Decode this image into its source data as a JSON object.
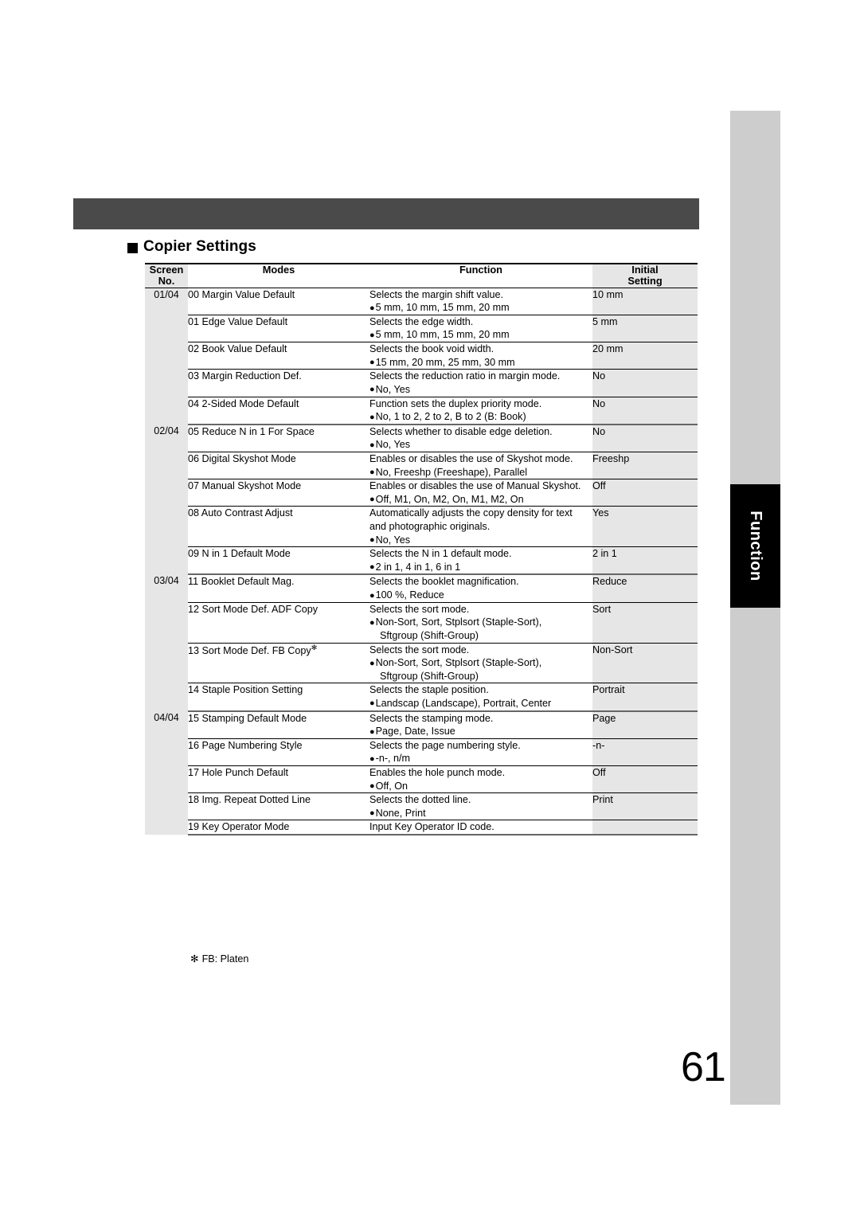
{
  "page": {
    "number": "61",
    "side_tab_label": "Function"
  },
  "heading": {
    "bullet": "square",
    "text": "Copier Settings"
  },
  "table": {
    "headers": {
      "screen_no_line1": "Screen",
      "screen_no_line2": "No.",
      "modes": "Modes",
      "function": "Function",
      "initial_line1": "Initial",
      "initial_line2": "Setting"
    },
    "groups": [
      {
        "screen_no": "01/04",
        "rows": [
          {
            "mode": "00 Margin Value Default",
            "desc": "Selects the margin shift value.",
            "options": [
              "5 mm, 10 mm, 15 mm, 20 mm"
            ],
            "initial": "10 mm"
          },
          {
            "mode": "01 Edge Value Default",
            "desc": "Selects the edge width.",
            "options": [
              "5 mm, 10 mm, 15 mm, 20 mm"
            ],
            "initial": "5 mm"
          },
          {
            "mode": "02 Book Value Default",
            "desc": "Selects the book void width.",
            "options": [
              "15 mm, 20 mm, 25 mm, 30 mm"
            ],
            "initial": "20 mm"
          },
          {
            "mode": "03 Margin Reduction Def.",
            "desc": "Selects the reduction ratio in margin mode.",
            "options": [
              "No, Yes"
            ],
            "initial": "No"
          },
          {
            "mode": "04 2-Sided Mode Default",
            "desc": "Function sets the duplex priority mode.",
            "options": [
              "No, 1 to 2, 2 to 2, B to 2 (B: Book)"
            ],
            "initial": "No"
          }
        ]
      },
      {
        "screen_no": "02/04",
        "rows": [
          {
            "mode": "05 Reduce N in 1 For Space",
            "desc": "Selects whether to disable edge deletion.",
            "options": [
              "No, Yes"
            ],
            "initial": "No"
          },
          {
            "mode": "06 Digital Skyshot Mode",
            "desc": "Enables or disables the use of Skyshot mode.",
            "options": [
              "No, Freeshp (Freeshape), Parallel"
            ],
            "initial": "Freeshp"
          },
          {
            "mode": "07 Manual Skyshot Mode",
            "desc": "Enables or disables the use of Manual Skyshot.",
            "options": [
              "Off, M1, On, M2, On, M1, M2, On"
            ],
            "initial": "Off"
          },
          {
            "mode": "08 Auto Contrast Adjust",
            "desc": "Automatically adjusts the copy density for text",
            "desc2": "and photographic originals.",
            "options": [
              "No, Yes"
            ],
            "initial": "Yes"
          },
          {
            "mode": "09 N in 1 Default Mode",
            "desc": "Selects the N in 1 default mode.",
            "options": [
              "2 in 1, 4 in 1, 6 in 1"
            ],
            "initial": "2 in 1"
          }
        ]
      },
      {
        "screen_no": "03/04",
        "rows": [
          {
            "mode": "11 Booklet Default Mag.",
            "desc": "Selects the booklet magnification.",
            "options": [
              "100 %, Reduce"
            ],
            "initial": "Reduce"
          },
          {
            "mode": "12 Sort Mode Def. ADF Copy",
            "desc": "Selects the sort mode.",
            "options": [
              "Non-Sort, Sort, Stplsort (Staple-Sort),"
            ],
            "options_cont": [
              "Sftgroup (Shift-Group)"
            ],
            "initial": "Sort"
          },
          {
            "mode": "13 Sort Mode Def. FB Copy",
            "mode_superscript": "✻",
            "desc": "Selects the sort mode.",
            "options": [
              "Non-Sort, Sort, Stplsort (Staple-Sort),"
            ],
            "options_cont": [
              "Sftgroup (Shift-Group)"
            ],
            "initial": "Non-Sort"
          },
          {
            "mode": "14 Staple Position Setting",
            "desc": "Selects the staple position.",
            "options": [
              "Landscap (Landscape), Portrait, Center"
            ],
            "initial": "Portrait"
          }
        ]
      },
      {
        "screen_no": "04/04",
        "rows": [
          {
            "mode": "15 Stamping Default Mode",
            "desc": "Selects the stamping mode.",
            "options": [
              "Page, Date, Issue"
            ],
            "initial": "Page"
          },
          {
            "mode": "16 Page Numbering Style",
            "desc": "Selects the page numbering style.",
            "options": [
              "-n-, n/m"
            ],
            "initial": "-n-"
          },
          {
            "mode": "17 Hole Punch Default",
            "desc": "Enables the hole punch mode.",
            "options": [
              "Off, On"
            ],
            "initial": "Off"
          },
          {
            "mode": "18 Img. Repeat Dotted Line",
            "desc": "Selects the dotted line.",
            "options": [
              "None, Print"
            ],
            "initial": "Print"
          },
          {
            "mode": "19 Key Operator Mode",
            "desc": "Input Key Operator ID code.",
            "options": [],
            "initial": ""
          }
        ]
      }
    ]
  },
  "footnote": {
    "mark": "✻",
    "text": "FB: Platen"
  },
  "colors": {
    "band": "#4a4a4a",
    "tab_strip": "#cdcdcd",
    "tab_active": "#000000",
    "cell_gray": "#e6e6e6"
  }
}
